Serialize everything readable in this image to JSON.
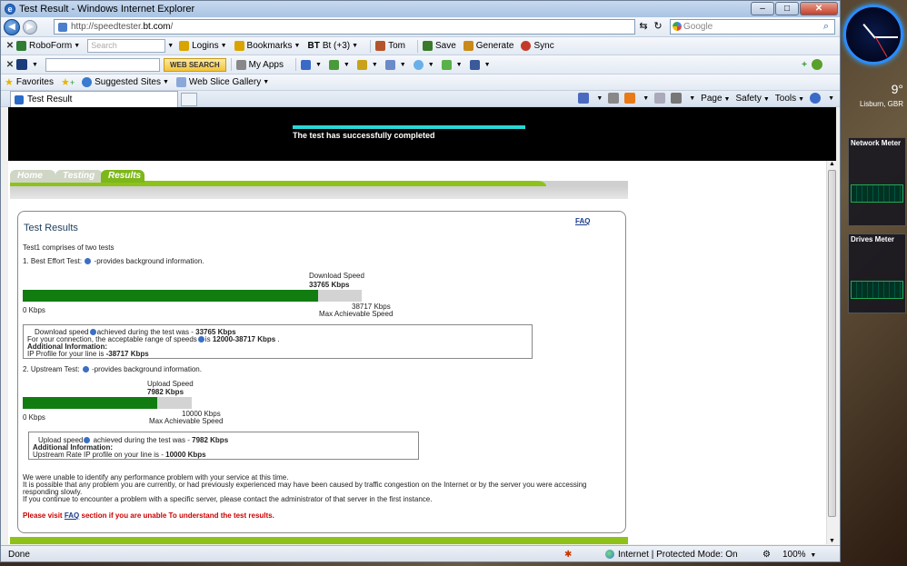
{
  "window": {
    "title": "Test Result - Windows Internet Explorer"
  },
  "address": {
    "url_prefix": "http://speedtester.",
    "url_domain": "bt.com",
    "url_suffix": "/",
    "search_placeholder": "Google"
  },
  "roboform": {
    "name": "RoboForm",
    "search_placeholder": "Search",
    "items": [
      "Logins",
      "Bookmarks",
      "Bt (+3)",
      "Tom",
      "Save",
      "Generate",
      "Sync"
    ]
  },
  "searchbar": {
    "button": "WEB SEARCH",
    "myapps": "My Apps"
  },
  "favorites": {
    "label": "Favorites",
    "items": [
      "Suggested Sites",
      "Web Slice Gallery"
    ]
  },
  "tab": {
    "label": "Test Result"
  },
  "commandbar": {
    "items": [
      "Page",
      "Safety",
      "Tools"
    ]
  },
  "banner": {
    "message": "The test has successfully completed",
    "progress": 1.0
  },
  "site_nav": {
    "tabs": [
      "Home",
      "Testing",
      "Results"
    ],
    "active": "Results"
  },
  "results": {
    "title": "Test Results",
    "faq": "FAQ",
    "intro": "Test1 comprises of two tests",
    "test1": {
      "heading_pre": "1. Best Effort Test:",
      "heading_post": "-provides background information.",
      "speed_label": "Download Speed",
      "speed_value": "33765 Kbps",
      "min_label": "0 Kbps",
      "max_value": "38717 Kbps",
      "max_label": "Max Achievable Speed",
      "fill_fraction": 0.872,
      "box_line1_pre": "Download speed",
      "box_line1_mid": "achieved during the test was -",
      "box_line1_val": "33765 Kbps",
      "box_line2_pre": "For your connection, the acceptable range of speeds",
      "box_line2_mid": "is",
      "box_line2_val": "12000-38717 Kbps",
      "box_line2_end": ".",
      "box_line3": "Additional Information:",
      "box_line4_pre": "IP Profile for your line is",
      "box_line4_val": "-38717 Kbps"
    },
    "test2": {
      "heading_pre": "2. Upstream Test:",
      "heading_post": "-provides background information.",
      "speed_label": "Upload Speed",
      "speed_value": "7982 Kbps",
      "min_label": "0 Kbps",
      "max_value": "10000 Kbps",
      "max_label": "Max Achievable Speed",
      "fill_fraction": 0.798,
      "box_line1_pre": "Upload speed",
      "box_line1_mid": "achieved during the test was -",
      "box_line1_val": "7982 Kbps",
      "box_line2": "Additional Information:",
      "box_line3_pre": "Upstream Rate IP profile on your line is -",
      "box_line3_val": "10000 Kbps"
    },
    "summary": [
      "We were unable to identify any performance problem with your service at this time.",
      "It is possible that any problem you are currently, or had previously experienced may have been caused by traffic congestion on the Internet or by the server you were accessing",
      "responding slowly.",
      "If you continue to encounter a problem with a specific server, please contact the administrator of that server in the first instance."
    ],
    "faq_note_pre": "Please visit",
    "faq_note_link": "FAQ",
    "faq_note_post": "section if you are unable To understand the test results."
  },
  "statusbar": {
    "status": "Done",
    "zone": "Internet | Protected Mode: On",
    "zoom": "100%"
  },
  "gadgets": {
    "weather_temp": "9°",
    "weather_city": "Lisburn, GBR",
    "network_title": "Network Meter",
    "drives_title": "Drives Meter"
  },
  "colors": {
    "accent_green": "#8ec21a",
    "bar_green": "#117d11",
    "progress_cyan": "#2ad6d6"
  }
}
